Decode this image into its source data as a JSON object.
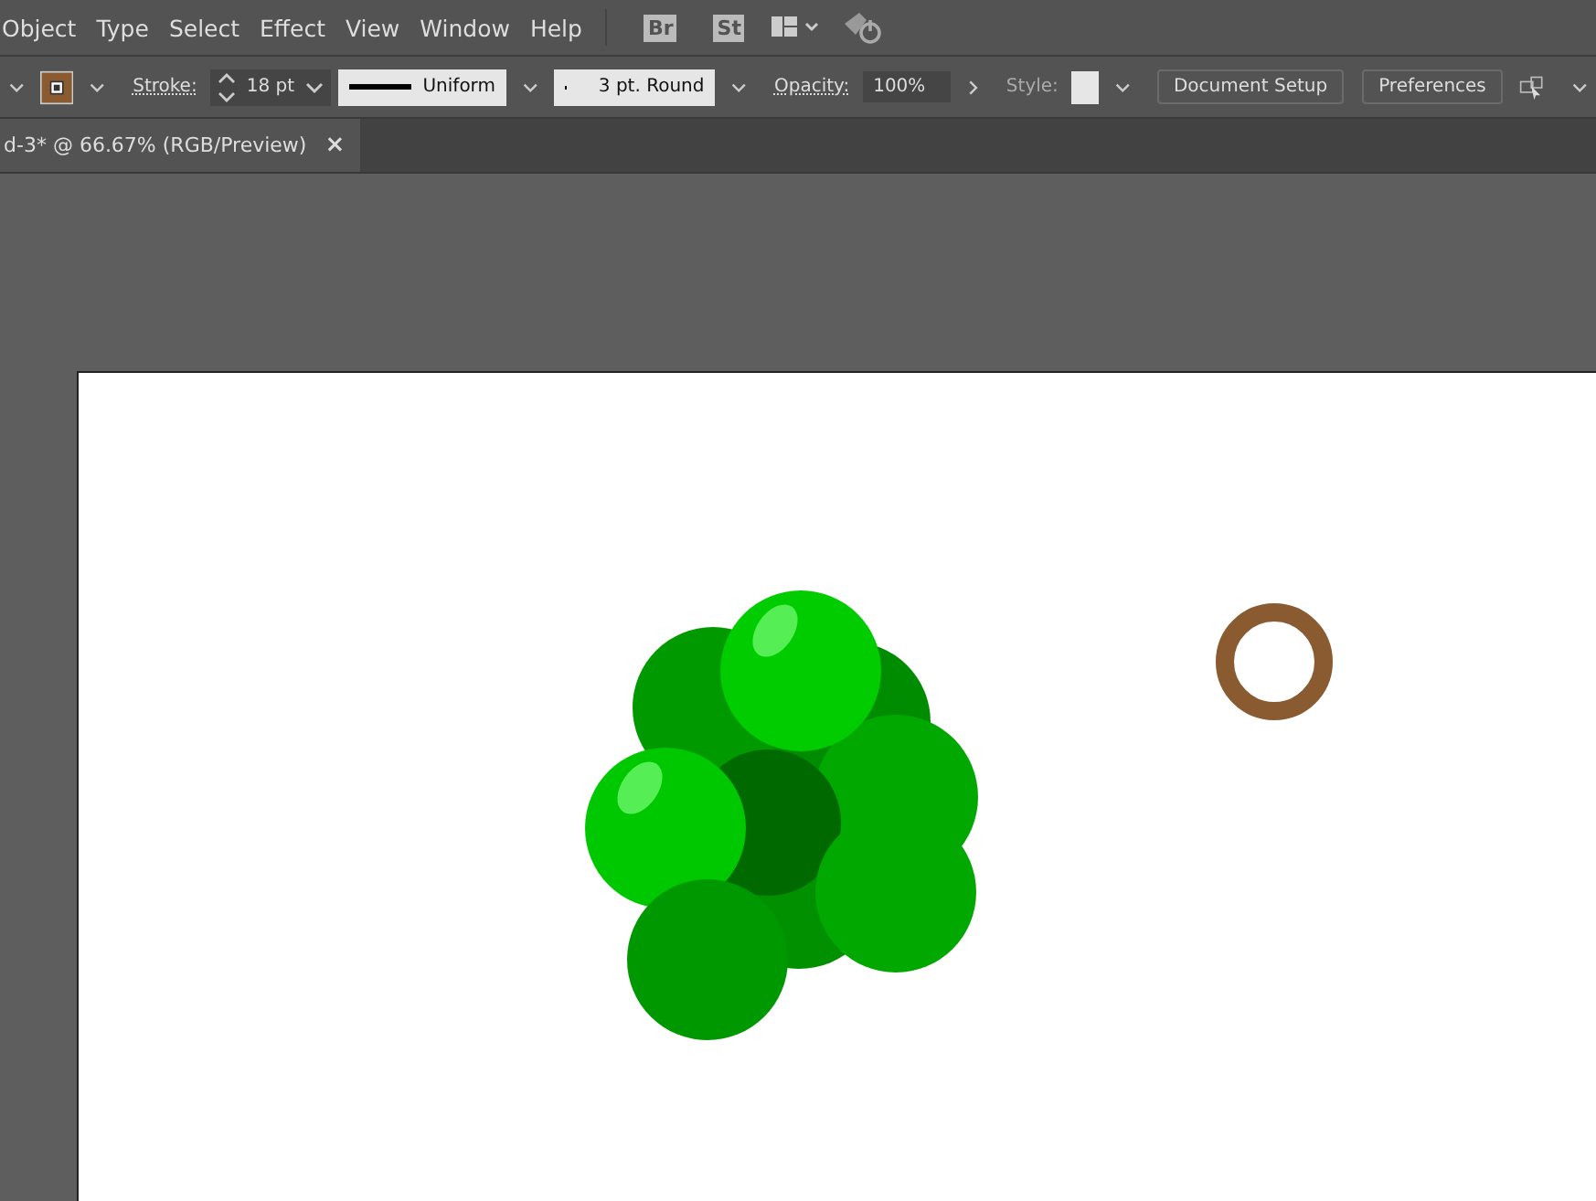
{
  "menu_bar": {
    "items": [
      "Object",
      "Type",
      "Select",
      "Effect",
      "View",
      "Window",
      "Help"
    ],
    "app_badges": [
      "Br",
      "St"
    ]
  },
  "control_bar": {
    "stroke_label": "Stroke:",
    "stroke_weight": "18 pt",
    "stroke_profile": "Uniform",
    "brush": "3 pt. Round",
    "opacity_label": "Opacity:",
    "opacity": "100%",
    "style_label": "Style:",
    "buttons": [
      "Document Setup",
      "Preferences"
    ]
  },
  "document_tab": {
    "title": "d-3* @ 66.67% (RGB/Preview)",
    "close": "×"
  }
}
